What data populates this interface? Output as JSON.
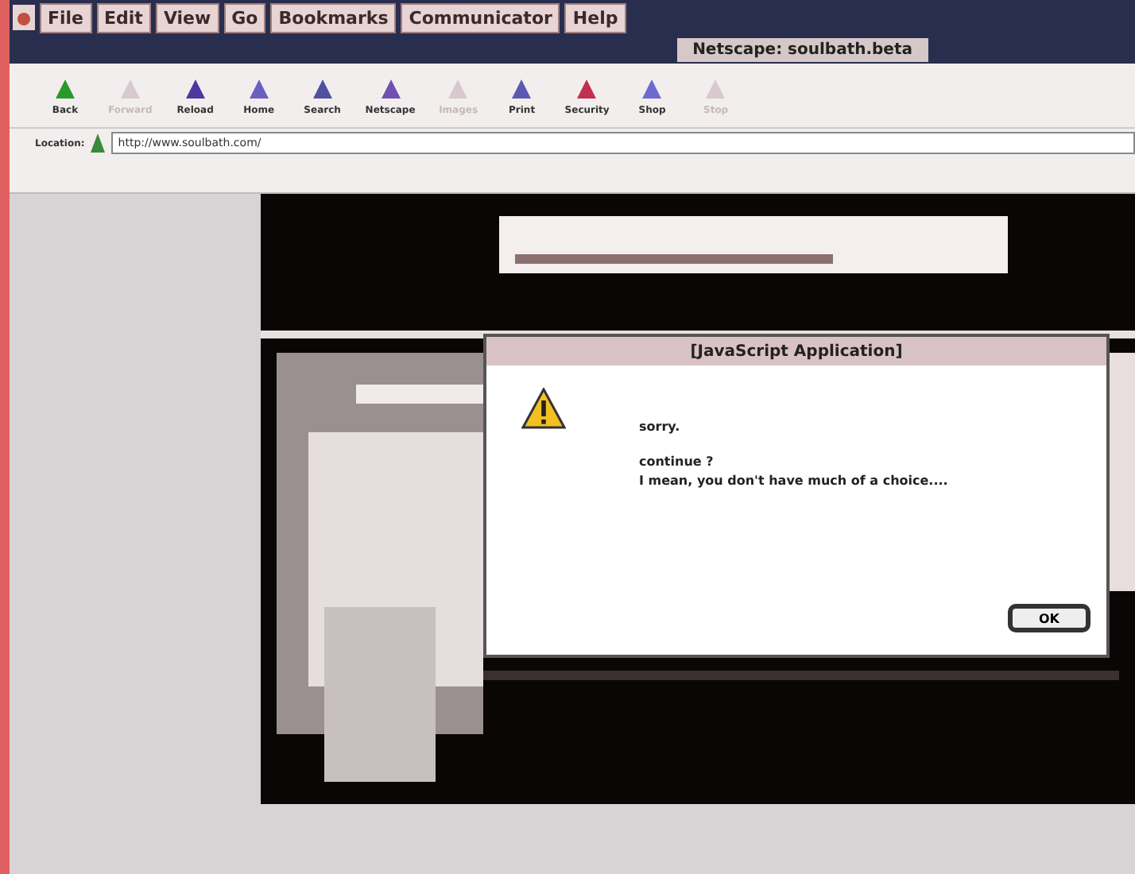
{
  "menu_bar": {
    "items": [
      "File",
      "Edit",
      "View",
      "Go",
      "Bookmarks",
      "Communicator",
      "Help"
    ]
  },
  "window": {
    "title": "Netscape: soulbath.beta"
  },
  "toolbar": [
    {
      "label": "Back",
      "disabled": false
    },
    {
      "label": "Forward",
      "disabled": true
    },
    {
      "label": "Reload",
      "disabled": false
    },
    {
      "label": "Home",
      "disabled": false
    },
    {
      "label": "Search",
      "disabled": false
    },
    {
      "label": "Netscape",
      "disabled": false
    },
    {
      "label": "Images",
      "disabled": true
    },
    {
      "label": "Print",
      "disabled": false
    },
    {
      "label": "Security",
      "disabled": false
    },
    {
      "label": "Shop",
      "disabled": false
    },
    {
      "label": "Stop",
      "disabled": true
    }
  ],
  "location": {
    "label": "Location:",
    "value": "http://www.soulbath.com/"
  },
  "dialog": {
    "title": "[JavaScript Application]",
    "paragraphs": [
      [
        "sorry."
      ],
      [
        "continue ?",
        "I mean, you don't have much of a choice...."
      ]
    ],
    "button": "OK"
  }
}
